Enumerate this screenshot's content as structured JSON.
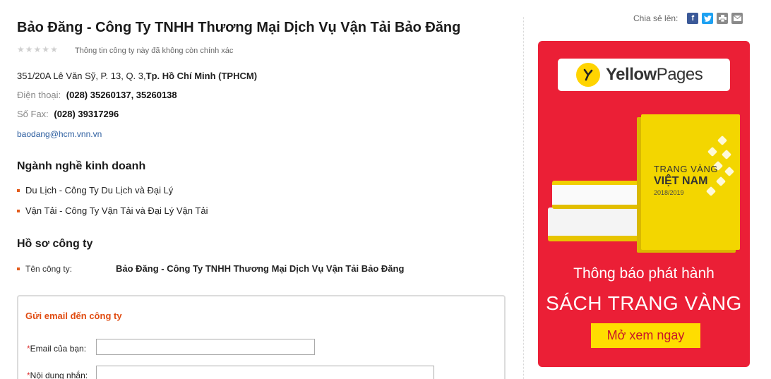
{
  "company": {
    "name": "Bảo Đăng - Công Ty TNHH Thương Mại Dịch Vụ Vận Tải Bảo Đăng",
    "rating_stars": 0,
    "rating_max": 5,
    "accuracy_note": "Thông tin công ty này đã không còn chính xác",
    "address_street": "351/20A Lê Văn Sỹ, P. 13, Q. 3,",
    "address_city": "Tp. Hồ Chí Minh (TPHCM)",
    "phone_label": "Điện thoại:",
    "phone_value": "(028) 35260137, 35260138",
    "fax_label": "Số Fax:",
    "fax_value": "(028) 39317296",
    "email": "baodang@hcm.vnn.vn"
  },
  "business": {
    "heading": "Ngành nghề kinh doanh",
    "items": [
      "Du Lịch - Công Ty Du Lịch và Đại Lý",
      "Vận Tải - Công Ty Vận Tải và Đại Lý Vận Tải"
    ]
  },
  "profile": {
    "heading": "Hồ sơ công ty",
    "company_name_label": "Tên công ty:",
    "company_name_value": "Bảo Đăng - Công Ty TNHH Thương Mại Dịch Vụ Vận Tải Bảo Đăng"
  },
  "email_form": {
    "title": "Gửi email đến công ty",
    "required_mark": "*",
    "email_label": "Email của bạn:",
    "email_value": "",
    "message_label": "Nội dung nhắn:",
    "message_value": ""
  },
  "share": {
    "label": "Chia sẻ lên:",
    "icons": [
      "facebook-icon",
      "twitter-icon",
      "print-icon",
      "mail-icon"
    ],
    "colors": {
      "facebook": "#3b5998",
      "twitter": "#1da1f2",
      "print": "#8a8a8a",
      "mail": "#8a8a8a"
    }
  },
  "ad": {
    "logo_text_bold": "Yellow",
    "logo_text_regular": "Pages",
    "book_title_line1": "TRANG VÀNG",
    "book_title_line2": "VIỆT NAM",
    "book_year": "2018/2019",
    "line1": "Thông báo phát hành",
    "line2": "SÁCH TRANG VÀNG",
    "button": "Mở xem ngay",
    "colors": {
      "background": "#eb1f36",
      "button": "#ffdd00",
      "book": "#f3d600"
    }
  }
}
